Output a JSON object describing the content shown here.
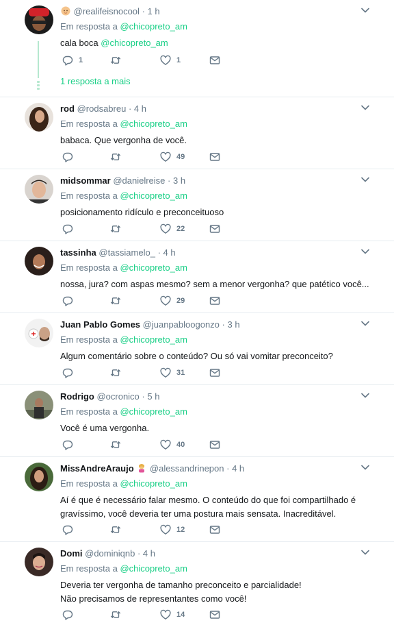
{
  "reply_prefix": "Em resposta a",
  "tweets": [
    {
      "name": "",
      "handle": "@realifeisnocool",
      "time": "1 h",
      "reply_to": "@chicopreto_am",
      "text_pre": "cala boca ",
      "text_mention": "@chicopreto_am",
      "replies": "1",
      "retweets": "",
      "likes": "1",
      "more_replies": "1 resposta a mais"
    },
    {
      "name": "rod",
      "handle": "@rodsabreu",
      "time": "4 h",
      "reply_to": "@chicopreto_am",
      "text": "babaca. Que vergonha de você.",
      "replies": "",
      "retweets": "",
      "likes": "49"
    },
    {
      "name": "midsommar",
      "handle": "@danielreise",
      "time": "3 h",
      "reply_to": "@chicopreto_am",
      "text": "posicionamento ridículo e preconceituoso",
      "replies": "",
      "retweets": "",
      "likes": "22"
    },
    {
      "name": "tassinha",
      "handle": "@tassiamelo_",
      "time": "4 h",
      "reply_to": "@chicopreto_am",
      "text": "nossa, jura? com aspas mesmo? sem a menor vergonha? que patético você...",
      "replies": "",
      "retweets": "",
      "likes": "29"
    },
    {
      "name": "Juan Pablo Gomes",
      "handle": "@juanpabloogonzo",
      "time": "3 h",
      "reply_to": "@chicopreto_am",
      "text": "Algum comentário sobre o conteúdo? Ou só vai vomitar preconceito?",
      "replies": "",
      "retweets": "",
      "likes": "31"
    },
    {
      "name": "Rodrigo",
      "handle": "@ocronico",
      "time": "5 h",
      "reply_to": "@chicopreto_am",
      "text": "Você é uma vergonha.",
      "replies": "",
      "retweets": "",
      "likes": "40"
    },
    {
      "name": "MissAndreAraujo",
      "handle": "@alessandrinepon",
      "time": "4 h",
      "reply_to": "@chicopreto_am",
      "text_line1": "Aí é que é necessário falar mesmo. O conteúdo do que foi compartilhado é",
      "text_line2": "gravíssimo, você deveria ter uma postura mais sensata. Inacreditável.",
      "replies": "",
      "retweets": "",
      "likes": "12"
    },
    {
      "name": "Domi",
      "handle": "@dominiqnb",
      "time": "4 h",
      "reply_to": "@chicopreto_am",
      "text_line1": "Deveria ter vergonha de tamanho preconceito e parcialidade!",
      "text_line2": "Não precisamos de representantes como você!",
      "replies": "",
      "retweets": "",
      "likes": "14"
    }
  ],
  "icons": [
    "reply-icon",
    "retweet-icon",
    "like-icon",
    "message-icon",
    "chevron-down-icon"
  ],
  "colors": {
    "link": "#19cf86",
    "muted": "#657786",
    "text": "#14171a",
    "divider": "#e6ecf0"
  }
}
